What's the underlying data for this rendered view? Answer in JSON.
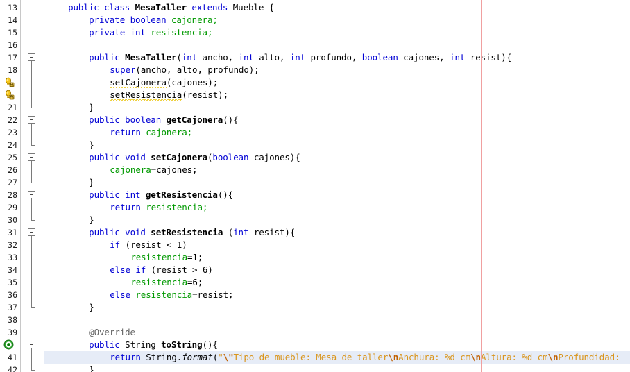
{
  "editor": {
    "language": "java",
    "class_name": "MesaTaller",
    "margin_column_marker_x": 693,
    "colors": {
      "background": "#ffffff",
      "keyword": "#0000d4",
      "field": "#009900",
      "string": "#d9951c",
      "escape": "#c06000",
      "annotation": "#646464",
      "line_number": "#1c1c1c",
      "current_line_highlight": "#e6ecf7",
      "margin_line": "#f0a0a0",
      "gutter_separator": "#c8c8c8",
      "warning_squiggle": "#e8c000",
      "fold_marker": "#7a7a7a"
    },
    "current_line": 41,
    "first_visible_line": 13,
    "last_visible_line": 42
  },
  "lines": [
    {
      "num": "13",
      "indent": 1,
      "fold": "none",
      "icon": "none",
      "tokens": [
        {
          "t": "public ",
          "c": "kw"
        },
        {
          "t": "class ",
          "c": "kw"
        },
        {
          "t": "MesaTaller",
          "c": "typ"
        },
        {
          "t": " ",
          "c": "pln"
        },
        {
          "t": "extends ",
          "c": "kw"
        },
        {
          "t": "Mueble {",
          "c": "pln"
        }
      ]
    },
    {
      "num": "14",
      "indent": 2,
      "fold": "none",
      "icon": "none",
      "tokens": [
        {
          "t": "private ",
          "c": "kw"
        },
        {
          "t": "boolean ",
          "c": "kw"
        },
        {
          "t": "cajonera;",
          "c": "fld"
        }
      ]
    },
    {
      "num": "15",
      "indent": 2,
      "fold": "none",
      "icon": "none",
      "tokens": [
        {
          "t": "private ",
          "c": "kw"
        },
        {
          "t": "int ",
          "c": "kw"
        },
        {
          "t": "resistencia;",
          "c": "fld"
        }
      ]
    },
    {
      "num": "16",
      "indent": 0,
      "fold": "none",
      "icon": "none",
      "tokens": []
    },
    {
      "num": "17",
      "indent": 2,
      "fold": "start",
      "icon": "none",
      "tokens": [
        {
          "t": "public ",
          "c": "kw"
        },
        {
          "t": "MesaTaller",
          "c": "mth"
        },
        {
          "t": "(",
          "c": "pln"
        },
        {
          "t": "int ",
          "c": "kw"
        },
        {
          "t": "ancho, ",
          "c": "pln"
        },
        {
          "t": "int ",
          "c": "kw"
        },
        {
          "t": "alto, ",
          "c": "pln"
        },
        {
          "t": "int ",
          "c": "kw"
        },
        {
          "t": "profundo, ",
          "c": "pln"
        },
        {
          "t": "boolean ",
          "c": "kw"
        },
        {
          "t": "cajones, ",
          "c": "pln"
        },
        {
          "t": "int ",
          "c": "kw"
        },
        {
          "t": "resist){",
          "c": "pln"
        }
      ]
    },
    {
      "num": "18",
      "indent": 3,
      "fold": "mid",
      "icon": "none",
      "tokens": [
        {
          "t": "super",
          "c": "kw"
        },
        {
          "t": "(ancho, alto, profundo);",
          "c": "pln"
        }
      ]
    },
    {
      "num": "",
      "indent": 3,
      "fold": "mid",
      "icon": "warning",
      "tokens": [
        {
          "t": "setCajonera",
          "c": "pln",
          "squiggle": true
        },
        {
          "t": "(cajones);",
          "c": "pln"
        }
      ]
    },
    {
      "num": "",
      "indent": 3,
      "fold": "mid",
      "icon": "warning",
      "tokens": [
        {
          "t": "setResistencia",
          "c": "pln",
          "squiggle": true
        },
        {
          "t": "(resist);",
          "c": "pln"
        }
      ]
    },
    {
      "num": "21",
      "indent": 2,
      "fold": "end",
      "icon": "none",
      "tokens": [
        {
          "t": "}",
          "c": "pln"
        }
      ]
    },
    {
      "num": "22",
      "indent": 2,
      "fold": "start",
      "icon": "none",
      "tokens": [
        {
          "t": "public ",
          "c": "kw"
        },
        {
          "t": "boolean ",
          "c": "kw"
        },
        {
          "t": "getCajonera",
          "c": "mth"
        },
        {
          "t": "(){",
          "c": "pln"
        }
      ]
    },
    {
      "num": "23",
      "indent": 3,
      "fold": "mid",
      "icon": "none",
      "tokens": [
        {
          "t": "return ",
          "c": "kw"
        },
        {
          "t": "cajonera;",
          "c": "fld"
        }
      ]
    },
    {
      "num": "24",
      "indent": 2,
      "fold": "end",
      "icon": "none",
      "tokens": [
        {
          "t": "}",
          "c": "pln"
        }
      ]
    },
    {
      "num": "25",
      "indent": 2,
      "fold": "start",
      "icon": "none",
      "tokens": [
        {
          "t": "public ",
          "c": "kw"
        },
        {
          "t": "void ",
          "c": "kw"
        },
        {
          "t": "setCajonera",
          "c": "mth"
        },
        {
          "t": "(",
          "c": "pln"
        },
        {
          "t": "boolean ",
          "c": "kw"
        },
        {
          "t": "cajones){",
          "c": "pln"
        }
      ]
    },
    {
      "num": "26",
      "indent": 3,
      "fold": "mid",
      "icon": "none",
      "tokens": [
        {
          "t": "cajonera",
          "c": "fld"
        },
        {
          "t": "=cajones;",
          "c": "pln"
        }
      ]
    },
    {
      "num": "27",
      "indent": 2,
      "fold": "end",
      "icon": "none",
      "tokens": [
        {
          "t": "}",
          "c": "pln"
        }
      ]
    },
    {
      "num": "28",
      "indent": 2,
      "fold": "start",
      "icon": "none",
      "tokens": [
        {
          "t": "public ",
          "c": "kw"
        },
        {
          "t": "int ",
          "c": "kw"
        },
        {
          "t": "getResistencia",
          "c": "mth"
        },
        {
          "t": "(){",
          "c": "pln"
        }
      ]
    },
    {
      "num": "29",
      "indent": 3,
      "fold": "mid",
      "icon": "none",
      "tokens": [
        {
          "t": "return ",
          "c": "kw"
        },
        {
          "t": "resistencia;",
          "c": "fld"
        }
      ]
    },
    {
      "num": "30",
      "indent": 2,
      "fold": "end",
      "icon": "none",
      "tokens": [
        {
          "t": "}",
          "c": "pln"
        }
      ]
    },
    {
      "num": "31",
      "indent": 2,
      "fold": "start",
      "icon": "none",
      "tokens": [
        {
          "t": "public ",
          "c": "kw"
        },
        {
          "t": "void ",
          "c": "kw"
        },
        {
          "t": "setResistencia ",
          "c": "mth"
        },
        {
          "t": "(",
          "c": "pln"
        },
        {
          "t": "int ",
          "c": "kw"
        },
        {
          "t": "resist){",
          "c": "pln"
        }
      ]
    },
    {
      "num": "32",
      "indent": 3,
      "fold": "mid",
      "icon": "none",
      "tokens": [
        {
          "t": "if ",
          "c": "kw"
        },
        {
          "t": "(resist < 1)",
          "c": "pln"
        }
      ]
    },
    {
      "num": "33",
      "indent": 4,
      "fold": "mid",
      "icon": "none",
      "tokens": [
        {
          "t": "resistencia",
          "c": "fld"
        },
        {
          "t": "=1;",
          "c": "pln"
        }
      ]
    },
    {
      "num": "34",
      "indent": 3,
      "fold": "mid",
      "icon": "none",
      "tokens": [
        {
          "t": "else if ",
          "c": "kw"
        },
        {
          "t": "(resist > 6)",
          "c": "pln"
        }
      ]
    },
    {
      "num": "35",
      "indent": 4,
      "fold": "mid",
      "icon": "none",
      "tokens": [
        {
          "t": "resistencia",
          "c": "fld"
        },
        {
          "t": "=6;",
          "c": "pln"
        }
      ]
    },
    {
      "num": "36",
      "indent": 3,
      "fold": "mid",
      "icon": "none",
      "tokens": [
        {
          "t": "else ",
          "c": "kw"
        },
        {
          "t": "resistencia",
          "c": "fld"
        },
        {
          "t": "=resist;",
          "c": "pln"
        }
      ]
    },
    {
      "num": "37",
      "indent": 2,
      "fold": "end",
      "icon": "none",
      "tokens": [
        {
          "t": "}",
          "c": "pln"
        }
      ]
    },
    {
      "num": "38",
      "indent": 0,
      "fold": "none",
      "icon": "none",
      "tokens": []
    },
    {
      "num": "39",
      "indent": 2,
      "fold": "none",
      "icon": "none",
      "tokens": [
        {
          "t": "@Override",
          "c": "ann"
        }
      ]
    },
    {
      "num": "",
      "indent": 2,
      "fold": "start",
      "icon": "override",
      "tokens": [
        {
          "t": "public ",
          "c": "kw"
        },
        {
          "t": "String ",
          "c": "pln"
        },
        {
          "t": "toString",
          "c": "mth"
        },
        {
          "t": "(){",
          "c": "pln"
        }
      ]
    },
    {
      "num": "41",
      "indent": 3,
      "fold": "mid",
      "icon": "none",
      "highlight": true,
      "tokens": [
        {
          "t": "return ",
          "c": "kw"
        },
        {
          "t": "String.",
          "c": "pln"
        },
        {
          "t": "format",
          "c": "ital"
        },
        {
          "t": "(",
          "c": "pln"
        },
        {
          "t": "\"",
          "c": "str"
        },
        {
          "t": "\\\"",
          "c": "esc"
        },
        {
          "t": "Tipo de mueble: Mesa de taller",
          "c": "str"
        },
        {
          "t": "\\n",
          "c": "esc"
        },
        {
          "t": "Anchura: %d cm",
          "c": "str"
        },
        {
          "t": "\\n",
          "c": "esc"
        },
        {
          "t": "Altura: %d cm",
          "c": "str"
        },
        {
          "t": "\\n",
          "c": "esc"
        },
        {
          "t": "Profundidad:",
          "c": "str"
        }
      ]
    },
    {
      "num": "42",
      "indent": 2,
      "fold": "end",
      "icon": "none",
      "tokens": [
        {
          "t": "}",
          "c": "pln"
        }
      ]
    }
  ],
  "icons": {
    "warning": "warning-bulb-icon",
    "override": "override-method-icon",
    "fold_collapse": "fold-collapse-icon"
  }
}
